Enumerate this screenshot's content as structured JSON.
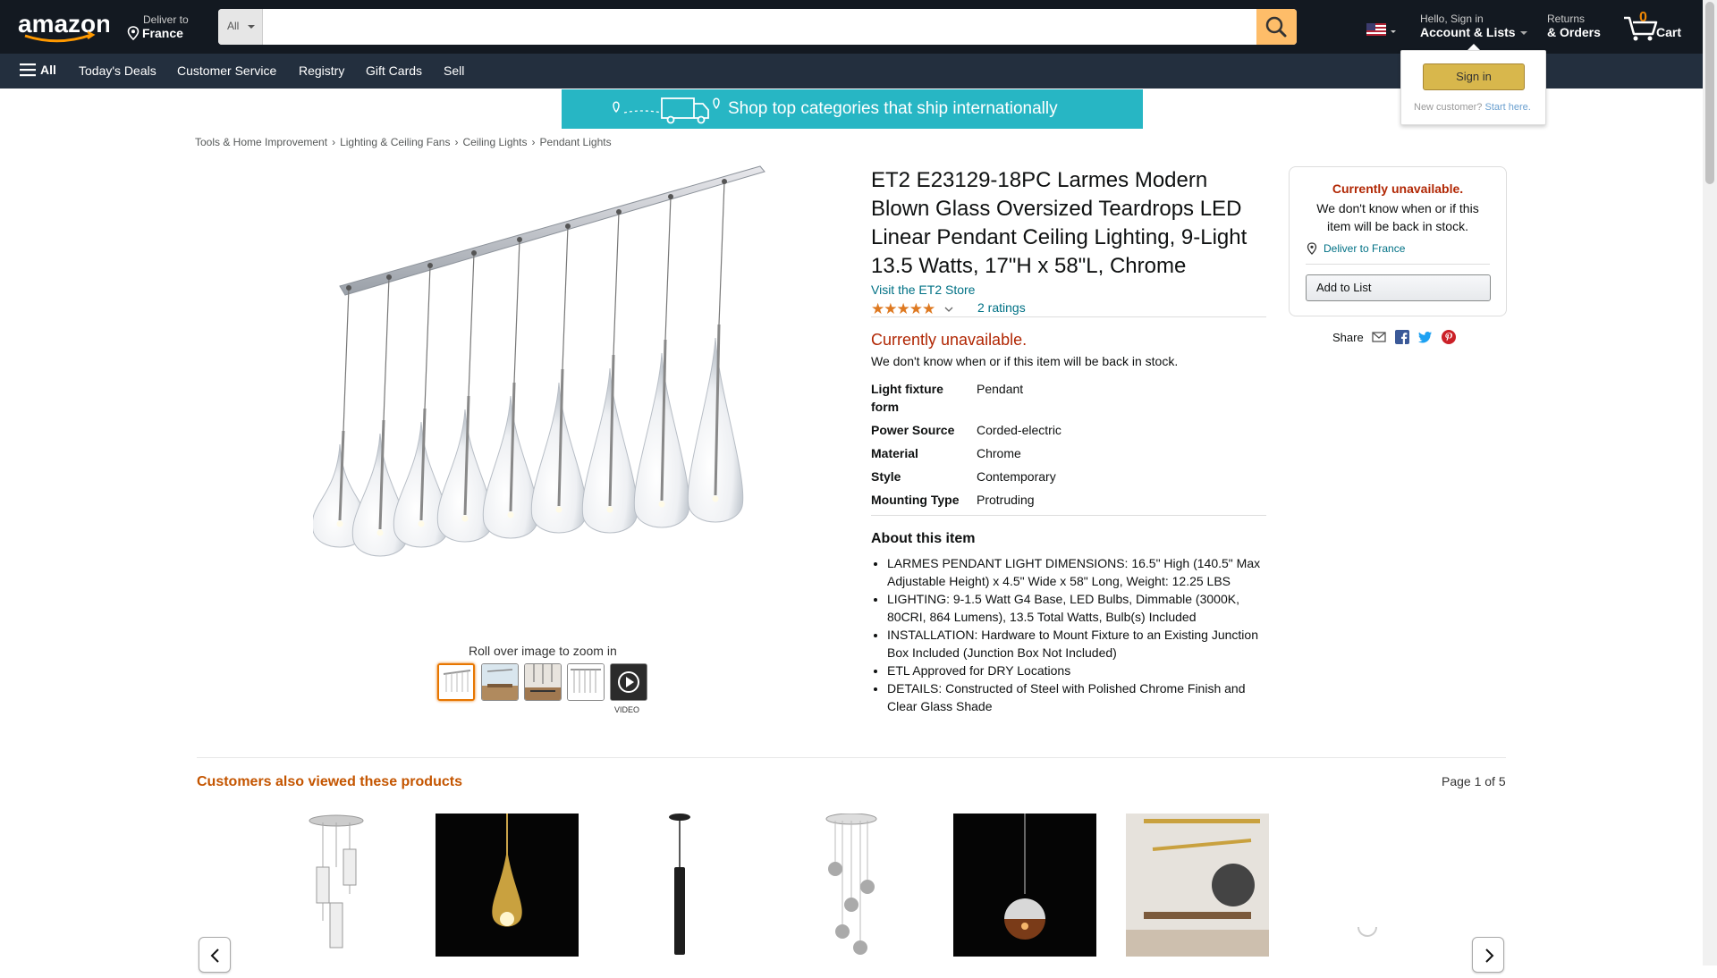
{
  "header": {
    "deliver_label": "Deliver to",
    "deliver_country": "France",
    "search_category": "All",
    "search_placeholder": "",
    "account_greeting": "Hello, Sign in",
    "account_label": "Account & Lists",
    "returns_label": "Returns",
    "orders_label": "& Orders",
    "cart_count": "0",
    "cart_label": "Cart"
  },
  "subnav": {
    "all_label": "All",
    "items": [
      "Today's Deals",
      "Customer Service",
      "Registry",
      "Gift Cards",
      "Sell"
    ]
  },
  "signin_flyout": {
    "button": "Sign in",
    "new_customer": "New customer?",
    "start_here": "Start here."
  },
  "banner": {
    "text": "Shop top categories that ship internationally"
  },
  "breadcrumb": [
    "Tools & Home Improvement",
    "Lighting & Ceiling Fans",
    "Ceiling Lights",
    "Pendant Lights"
  ],
  "gallery": {
    "zoom_text": "Roll over image to zoom in",
    "video_label": "VIDEO"
  },
  "product": {
    "title": "ET2 E23129-18PC Larmes Modern Blown Glass Oversized Teardrops LED Linear Pendant Ceiling Lighting, 9-Light 13.5 Watts, 17\"H x 58\"L, Chrome",
    "store_link": "Visit the ET2 Store",
    "stars": "★★★★★",
    "rating_value": 5,
    "ratings_count": "2 ratings",
    "availability": "Currently unavailable.",
    "availability_sub": "We don't know when or if this item will be back in stock.",
    "specs": [
      {
        "k": "Light fixture form",
        "v": "Pendant"
      },
      {
        "k": "Power Source",
        "v": "Corded-electric"
      },
      {
        "k": "Material",
        "v": "Chrome"
      },
      {
        "k": "Style",
        "v": "Contemporary"
      },
      {
        "k": "Mounting Type",
        "v": "Protruding"
      }
    ],
    "about_heading": "About this item",
    "bullets": [
      "LARMES PENDANT LIGHT DIMENSIONS: 16.5\" High (140.5\" Max Adjustable Height) x 4.5\" Wide x 58\" Long, Weight: 12.25 LBS",
      "LIGHTING: 9-1.5 Watt G4 Base, LED Bulbs, Dimmable (3000K, 80CRI, 864 Lumens), 13.5 Total Watts, Bulb(s) Included",
      "INSTALLATION: Hardware to Mount Fixture to an Existing Junction Box Included (Junction Box Not Included)",
      "ETL Approved for DRY Locations",
      "DETAILS: Constructed of Steel with Polished Chrome Finish and Clear Glass Shade"
    ]
  },
  "buybox": {
    "unavailable": "Currently unavailable.",
    "sub": "We don't know when or if this item will be back in stock.",
    "deliver": "Deliver to France",
    "add_to_list": "Add to List"
  },
  "share": {
    "label": "Share"
  },
  "carousel": {
    "heading": "Customers also viewed these products",
    "page": "Page 1 of 5"
  },
  "colors": {
    "header_bg": "#131921",
    "subnav_bg": "#232f3e",
    "link": "#007185",
    "alert": "#b12704",
    "accent": "#febd69"
  }
}
